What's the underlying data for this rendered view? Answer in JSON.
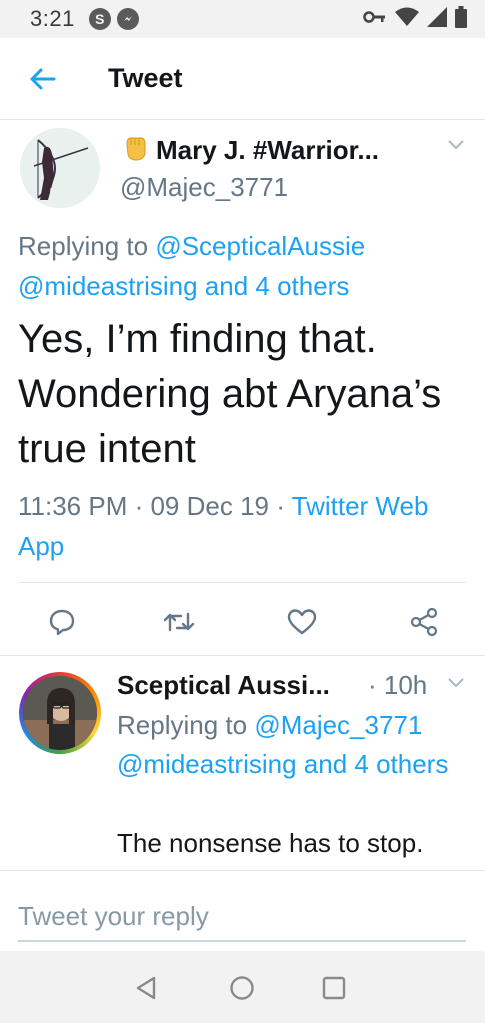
{
  "status_bar": {
    "time": "3:21",
    "notification_icons": [
      "S",
      "messenger-icon"
    ]
  },
  "header": {
    "title": "Tweet"
  },
  "tweet": {
    "author_name": "Mary J. #Warrior...",
    "author_badge_icon": "raised-fist-emoji",
    "author_handle": "@Majec_3771",
    "replying_prefix": "Replying to ",
    "replying_to_1": "@ScepticalAussie",
    "replying_to_2": "@mideastrising and 4 others",
    "text": "Yes, I’m finding that. Wondering abt Aryana’s true intent",
    "timestamp": "11:36 PM · 09 Dec 19 · ",
    "source": "Twitter Web App",
    "actions": [
      "reply-icon",
      "retweet-icon",
      "like-icon",
      "share-icon"
    ]
  },
  "reply": {
    "author_name": "Sceptical Aussi...",
    "time": "· 10h",
    "replying_prefix": "Replying to ",
    "replying_to_1": "@Majec_3771",
    "replying_to_2": "@mideastrising and 4 others",
    "text": "The nonsense has to stop."
  },
  "compose": {
    "placeholder": "Tweet your reply"
  },
  "colors": {
    "accent": "#1da1f2",
    "secondary_text": "#657786",
    "divider": "#e1e8ed"
  }
}
